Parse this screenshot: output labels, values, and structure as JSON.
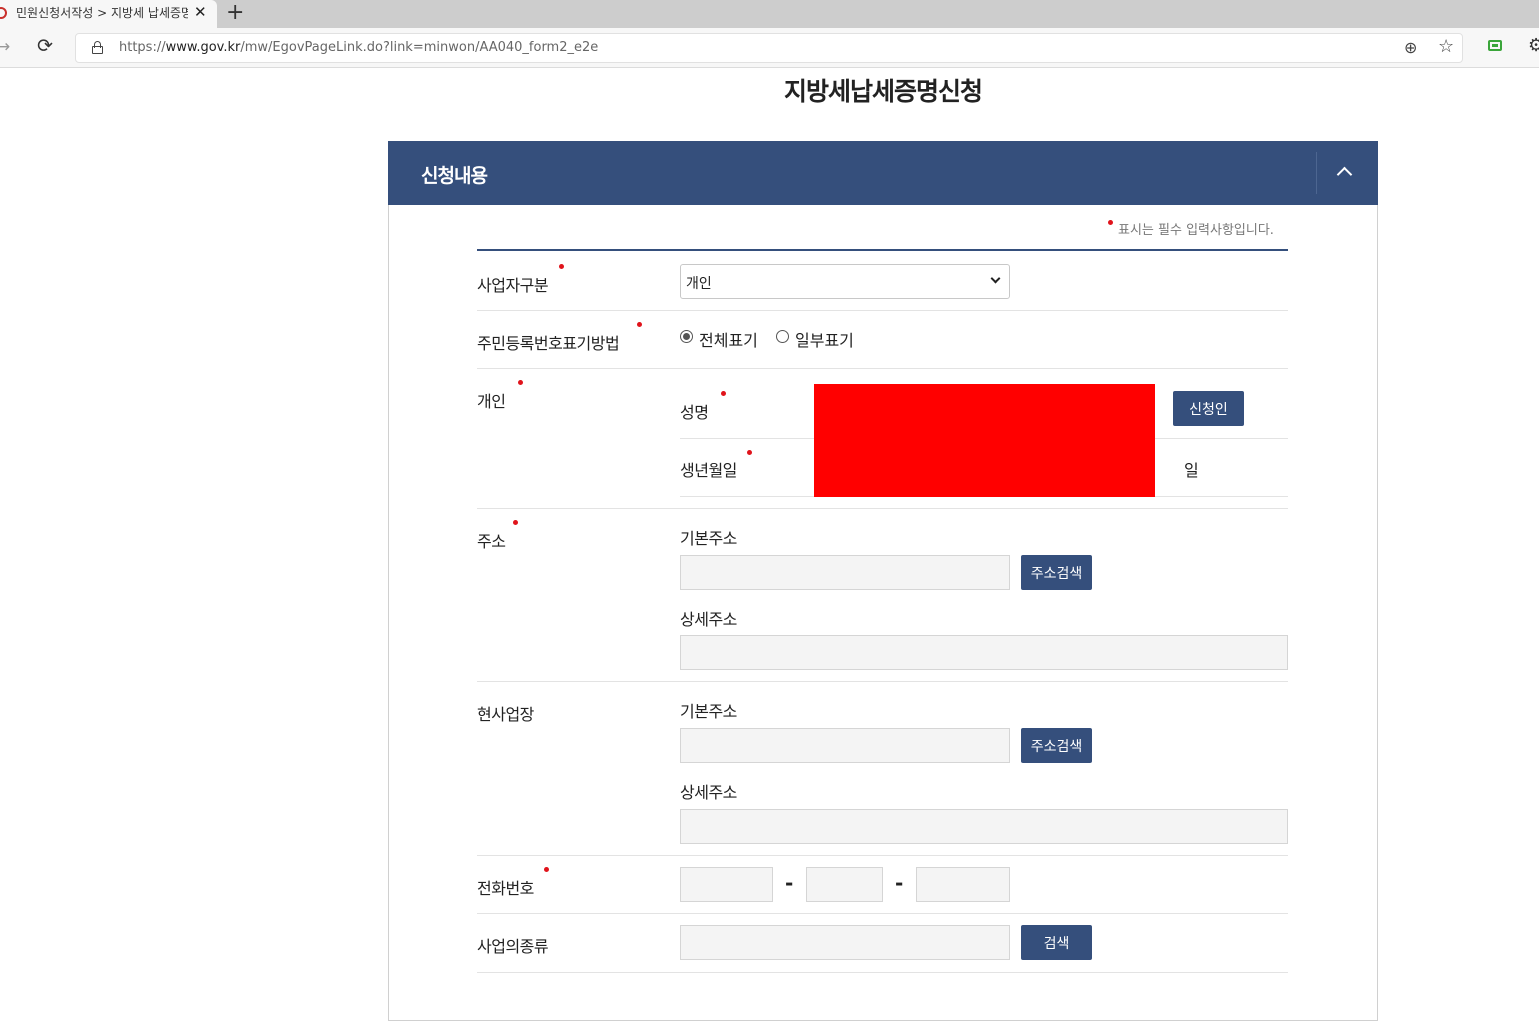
{
  "browser": {
    "tab_title": "민원신청서작성 > 지방세 납세증명신청",
    "new_tab": "+",
    "close": "✕",
    "url_prefix": "https://",
    "url_host": "www.gov.kr",
    "url_path": "/mw/EgovPageLink.do?link=minwon/AA040_form2_e2e"
  },
  "page": {
    "title": "지방세납세증명신청"
  },
  "panel": {
    "title": "신청내용",
    "required_note": "표시는 필수 입력사항입니다."
  },
  "form": {
    "business_type": {
      "label": "사업자구분",
      "selected": "개인"
    },
    "id_display": {
      "label": "주민등록번호표기방법",
      "options": [
        "전체표기",
        "일부표기"
      ],
      "selected_index": 0
    },
    "individual": {
      "label": "개인",
      "name_label": "성명",
      "applicant_button": "신청인",
      "birth_label": "생년월일",
      "day_suffix": "일"
    },
    "address": {
      "label": "주소",
      "basic_label": "기본주소",
      "search_button": "주소검색",
      "detail_label": "상세주소"
    },
    "workplace": {
      "label": "현사업장",
      "basic_label": "기본주소",
      "search_button": "주소검색",
      "detail_label": "상세주소"
    },
    "phone": {
      "label": "전화번호",
      "separator": "-"
    },
    "business_kind": {
      "label": "사업의종류",
      "search_button": "검색"
    }
  },
  "colors": {
    "header_bg": "#354f7c",
    "button_bg": "#354f7c",
    "required_dot": "#e0131b",
    "redaction": "#ff0000"
  }
}
